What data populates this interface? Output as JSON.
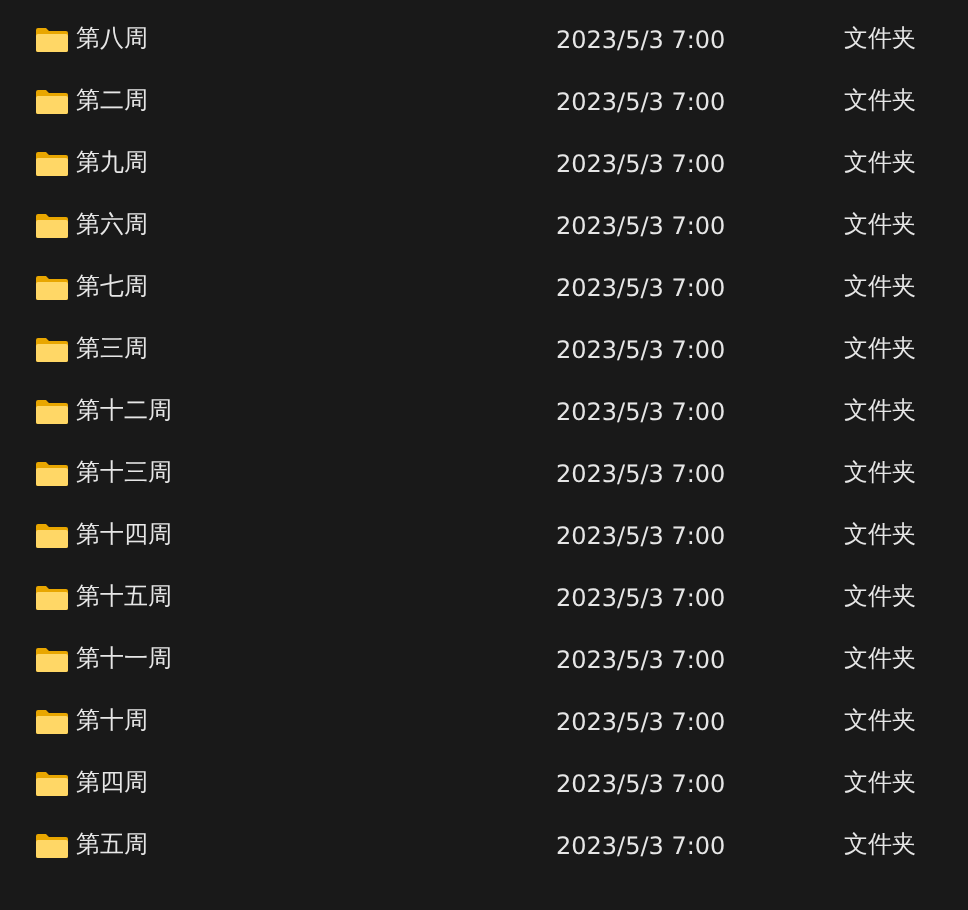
{
  "rows": [
    {
      "name": "第八周",
      "modified": "2023/5/3 7:00",
      "type": "文件夹"
    },
    {
      "name": "第二周",
      "modified": "2023/5/3 7:00",
      "type": "文件夹"
    },
    {
      "name": "第九周",
      "modified": "2023/5/3 7:00",
      "type": "文件夹"
    },
    {
      "name": "第六周",
      "modified": "2023/5/3 7:00",
      "type": "文件夹"
    },
    {
      "name": "第七周",
      "modified": "2023/5/3 7:00",
      "type": "文件夹"
    },
    {
      "name": "第三周",
      "modified": "2023/5/3 7:00",
      "type": "文件夹"
    },
    {
      "name": "第十二周",
      "modified": "2023/5/3 7:00",
      "type": "文件夹"
    },
    {
      "name": "第十三周",
      "modified": "2023/5/3 7:00",
      "type": "文件夹"
    },
    {
      "name": "第十四周",
      "modified": "2023/5/3 7:00",
      "type": "文件夹"
    },
    {
      "name": "第十五周",
      "modified": "2023/5/3 7:00",
      "type": "文件夹"
    },
    {
      "name": "第十一周",
      "modified": "2023/5/3 7:00",
      "type": "文件夹"
    },
    {
      "name": "第十周",
      "modified": "2023/5/3 7:00",
      "type": "文件夹"
    },
    {
      "name": "第四周",
      "modified": "2023/5/3 7:00",
      "type": "文件夹"
    },
    {
      "name": "第五周",
      "modified": "2023/5/3 7:00",
      "type": "文件夹"
    }
  ]
}
